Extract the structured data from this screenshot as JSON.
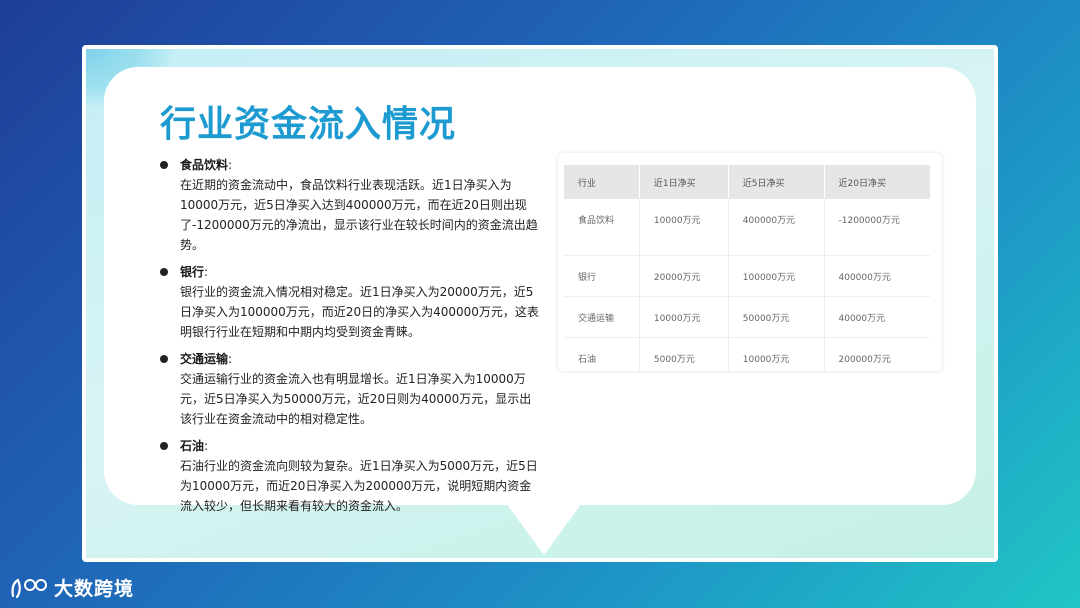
{
  "slide": {
    "title": "行业资金流入情况",
    "points": [
      {
        "name": "食品饮料",
        "text": "在近期的资金流动中，食品饮料行业表现活跃。近1日净买入为10000万元，近5日净买入达到400000万元，而在近20日则出现了-1200000万元的净流出，显示该行业在较长时间内的资金流出趋势。"
      },
      {
        "name": "银行",
        "text": "银行业的资金流入情况相对稳定。近1日净买入为20000万元，近5日净买入为100000万元，而近20日的净买入为400000万元，这表明银行行业在短期和中期内均受到资金青睐。"
      },
      {
        "name": "交通运输",
        "text": "交通运输行业的资金流入也有明显增长。近1日净买入为10000万元，近5日净买入为50000万元，近20日则为40000万元，显示出该行业在资金流动中的相对稳定性。"
      },
      {
        "name": "石油",
        "text": "石油行业的资金流向则较为复杂。近1日净买入为5000万元，近5日为10000万元，而近20日净买入为200000万元，说明短期内资金流入较少，但长期来看有较大的资金流入。"
      }
    ],
    "colon": ":"
  },
  "table": {
    "headers": [
      "行业",
      "近1日净买",
      "近5日净买",
      "近20日净买"
    ],
    "rows": [
      [
        "食品饮料",
        "10000万元",
        "400000万元",
        "-1200000万元"
      ],
      [
        "银行",
        "20000万元",
        "100000万元",
        "400000万元"
      ],
      [
        "交通运输",
        "10000万元",
        "50000万元",
        "40000万元"
      ],
      [
        "石油",
        "5000万元",
        "10000万元",
        "200000万元"
      ]
    ]
  },
  "brand": {
    "name": "大数跨境",
    "icon": "brand-logo-icon"
  },
  "colors": {
    "title": "#1d9bd1",
    "background_start": "#1f3e97",
    "background_end": "#21c6c5"
  }
}
